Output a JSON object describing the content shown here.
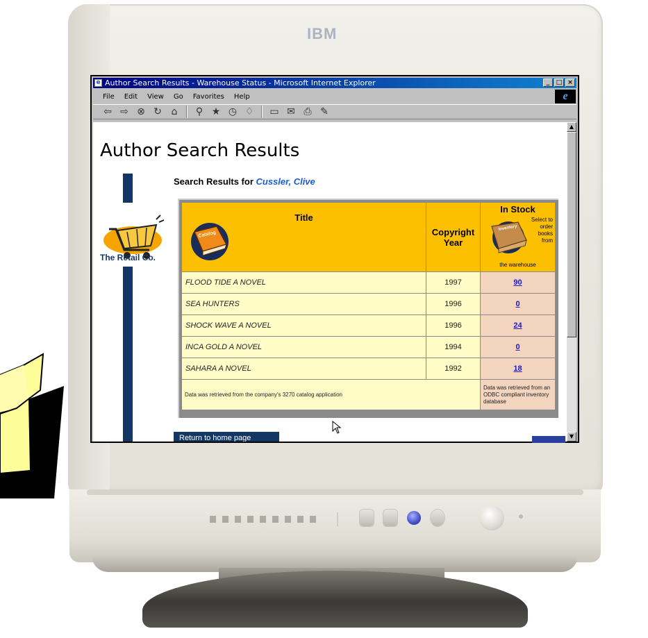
{
  "monitor": {
    "brand": "IBM"
  },
  "window": {
    "title": "Author Search Results - Warehouse Status - Microsoft Internet Explorer",
    "controls": [
      "minimize",
      "maximize",
      "close"
    ]
  },
  "menu": [
    "File",
    "Edit",
    "View",
    "Go",
    "Favorites",
    "Help"
  ],
  "toolbar": {
    "icons": [
      "back-icon",
      "forward-icon",
      "stop-icon",
      "refresh-icon",
      "home-icon",
      "search-icon",
      "favorites-icon",
      "history-icon",
      "channels-icon",
      "fullscreen-icon",
      "mail-icon",
      "print-icon",
      "edit-icon"
    ]
  },
  "page": {
    "title": "Author Search Results",
    "subhead_prefix": "Search Results for",
    "author": "Cussler, Clive",
    "logo_text": "The Retail Co.",
    "home_button": "Return to home page"
  },
  "table": {
    "headers": {
      "title": "Title",
      "year": "Copyright Year",
      "stock": "In Stock"
    },
    "catalog_label": "Catalog",
    "inventory_label": "Inventory",
    "stock_note": "Select to order books from",
    "stock_foot": "the warehouse",
    "rows": [
      {
        "title": "FLOOD TIDE A NOVEL",
        "year": "1997",
        "stock": "90"
      },
      {
        "title": "SEA HUNTERS",
        "year": "1996",
        "stock": "0"
      },
      {
        "title": "SHOCK WAVE A NOVEL",
        "year": "1996",
        "stock": "24"
      },
      {
        "title": "INCA GOLD A NOVEL",
        "year": "1994",
        "stock": "0"
      },
      {
        "title": "SAHARA A NOVEL",
        "year": "1992",
        "stock": "18"
      }
    ],
    "footer_left": "Data was retrieved from the company's 3270 catalog application",
    "footer_right": "Data was retrieved from an ODBC compliant inventory database"
  },
  "colors": {
    "header_bg": "#fdc000",
    "row_bg": "#fffcc8",
    "stock_bg": "#f3d4be",
    "navy": "#133764",
    "link": "#1a1ac8",
    "author": "#1a5cd6"
  }
}
